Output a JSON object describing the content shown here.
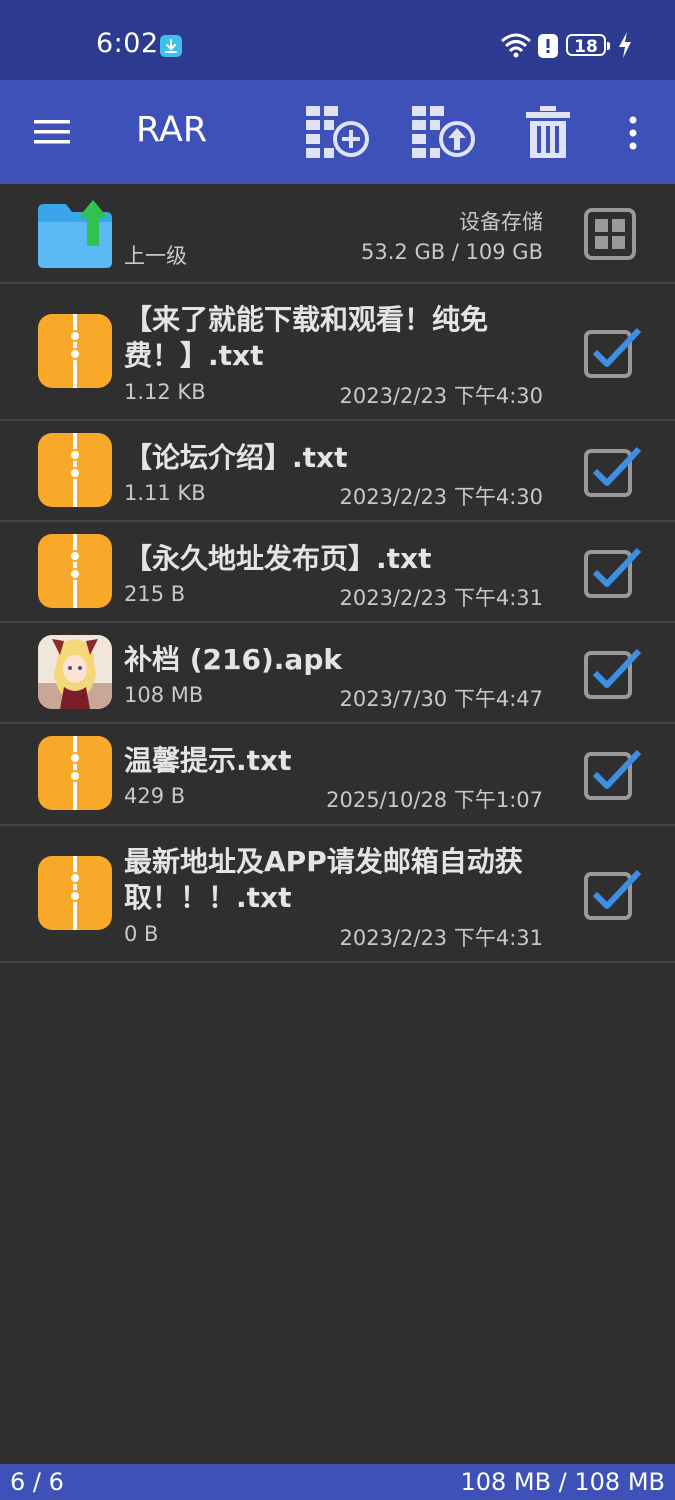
{
  "status_bar": {
    "time": "6:02",
    "battery": "18",
    "icons": [
      "download-badge-icon",
      "wifi-icon",
      "alert-icon",
      "battery-icon",
      "charging-icon"
    ]
  },
  "toolbar": {
    "title": "RAR",
    "buttons": [
      "menu-icon",
      "add-to-archive-icon",
      "extract-icon",
      "delete-icon",
      "more-icon"
    ]
  },
  "parent_row": {
    "label": "上一级",
    "storage_label": "设备存储",
    "storage_usage": "53.2 GB / 109 GB"
  },
  "files": [
    {
      "name": "【来了就能下载和观看！纯免费！】.txt",
      "size": "1.12 KB",
      "date": "2023/2/23 下午4:30",
      "icon": "archive-file-icon",
      "checked": true
    },
    {
      "name": "【论坛介绍】.txt",
      "size": "1.11 KB",
      "date": "2023/2/23 下午4:30",
      "icon": "archive-file-icon",
      "checked": true
    },
    {
      "name": "【永久地址发布页】.txt",
      "size": "215 B",
      "date": "2023/2/23 下午4:31",
      "icon": "archive-file-icon",
      "checked": true
    },
    {
      "name": "补档 (216).apk",
      "size": "108 MB",
      "date": "2023/7/30 下午4:47",
      "icon": "apk-thumbnail",
      "checked": true
    },
    {
      "name": "温馨提示.txt",
      "size": "429 B",
      "date": "2025/10/28 下午1:07",
      "icon": "archive-file-icon",
      "checked": true
    },
    {
      "name": "最新地址及APP请发邮箱自动获取！！！.txt",
      "size": "0 B",
      "date": "2023/2/23 下午4:31",
      "icon": "archive-file-icon",
      "checked": true
    }
  ],
  "footer": {
    "count": "6 / 6",
    "total": "108 MB / 108 MB"
  },
  "colors": {
    "status_bar": "#2c3a8f",
    "toolbar": "#3d51b8",
    "background": "#2f2f2f",
    "checkmark": "#3d8fe6",
    "file_icon": "#f8a92a"
  }
}
